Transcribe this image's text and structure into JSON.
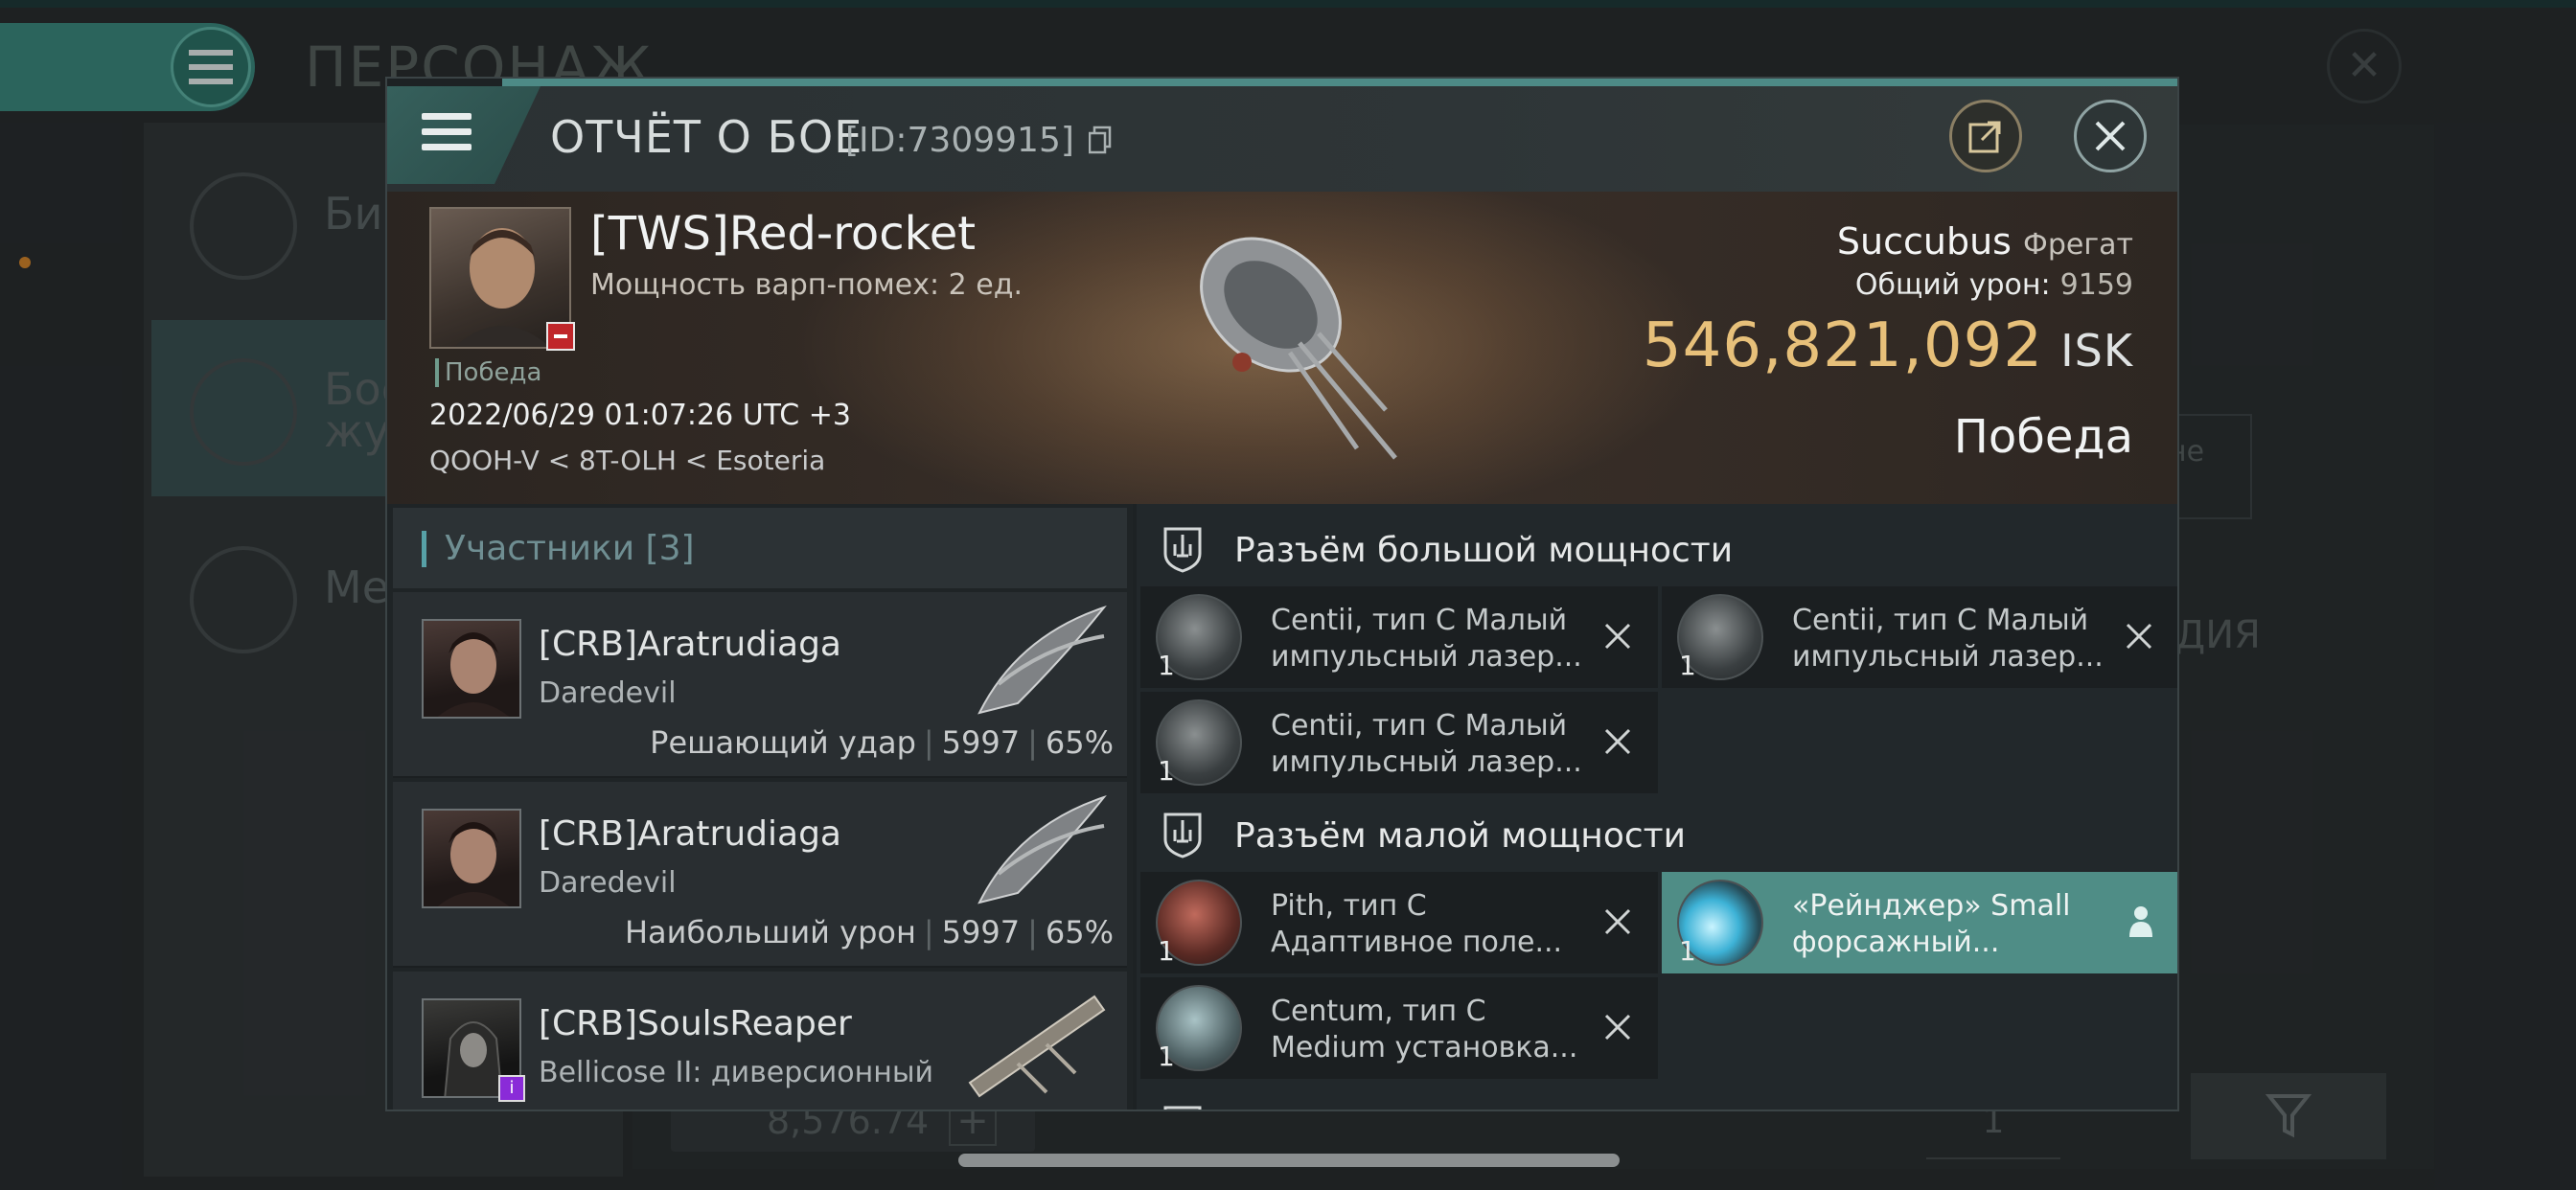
{
  "background": {
    "title": "ПЕРСОНАЖ",
    "menu_items": [
      {
        "label": "Био"
      },
      {
        "label": "Бое\nжур"
      },
      {
        "label": "Мед"
      }
    ],
    "right_text": "ДИЯ",
    "right_box_text": "не",
    "bottom_value": "8,576.74",
    "page_value": "1"
  },
  "modal": {
    "title": "ОТЧЁТ О БОЕ",
    "report_id": "[ID:7309915]",
    "victim": {
      "name": "[TWS]Red-rocket",
      "warp_scramble": "Мощность варп-помех: 2 ед.",
      "status": "Победа",
      "datetime": "2022/06/29 01:07:26 UTC +3",
      "location": "QOOH-V < 8T-OLH < Esoteria"
    },
    "ship": {
      "name": "Succubus",
      "class": "Фрегат",
      "total_damage_label": "Общий урон:",
      "total_damage": "9159",
      "isk_value": "546,821,092",
      "isk_unit": "ISK",
      "outcome": "Победа"
    },
    "participants": {
      "header": "Участники [3]",
      "items": [
        {
          "name": "[CRB]Aratrudiaga",
          "ship": "Daredevil",
          "role": "Решающий удар",
          "damage": "5997",
          "percent": "65%"
        },
        {
          "name": "[CRB]Aratrudiaga",
          "ship": "Daredevil",
          "role": "Наибольший урон",
          "damage": "5997",
          "percent": "65%"
        },
        {
          "name": "[CRB]SoulsReaper",
          "ship": "Bellicose II: диверсионный"
        }
      ]
    },
    "fitting": {
      "high_slots_label": "Разъём большой мощности",
      "low_slots_label": "Разъём малой мощности",
      "high": [
        {
          "qty": "1",
          "line1": "Centii, тип C Малый",
          "line2": "импульсный лазер..."
        },
        {
          "qty": "1",
          "line1": "Centii, тип C Малый",
          "line2": "импульсный лазер..."
        },
        {
          "qty": "1",
          "line1": "Centii, тип C Малый",
          "line2": "импульсный лазер..."
        }
      ],
      "low": [
        {
          "qty": "1",
          "line1": "Pith, тип C",
          "line2": "Адаптивное поле..."
        },
        {
          "qty": "1",
          "line1": "«Рейнджер» Small",
          "line2": "форсажный..."
        },
        {
          "qty": "1",
          "line1": "Centum, тип C",
          "line2": "Medium установка..."
        }
      ]
    }
  },
  "colors": {
    "accent": "#4f8d86",
    "isk": "#e7c07a",
    "corp_badge": "#c0262a"
  }
}
